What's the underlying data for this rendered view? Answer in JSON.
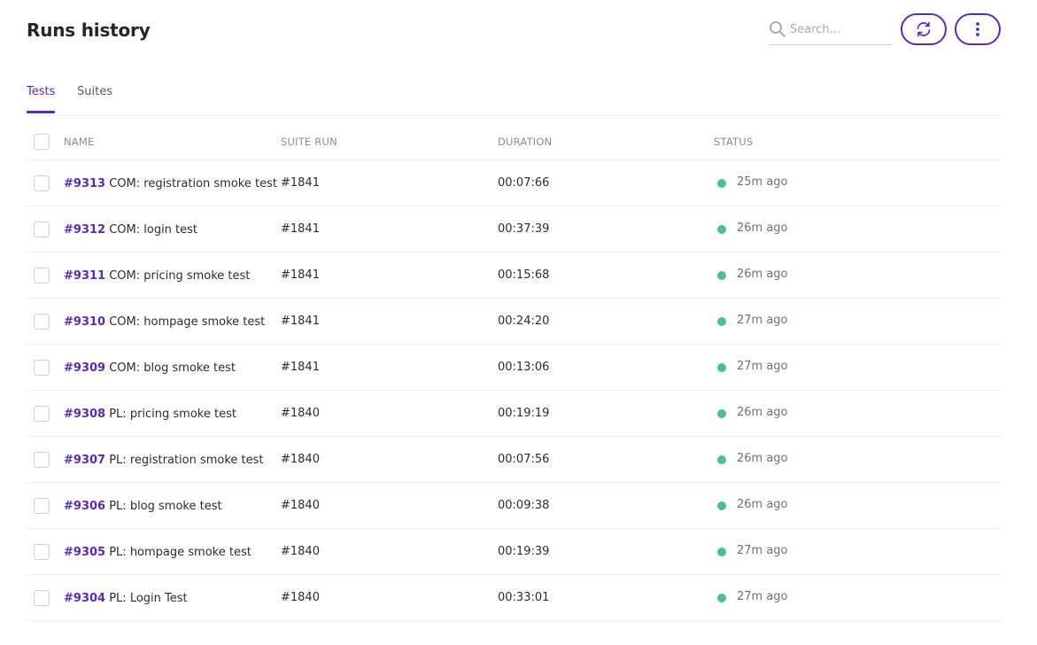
{
  "header": {
    "title": "Runs history",
    "search_placeholder": "Search...",
    "search_value": "",
    "refresh_icon": "refresh-icon",
    "more_icon": "more-vertical-icon"
  },
  "colors": {
    "accent": "#5b2bb8",
    "status_success": "#4cbf8a"
  },
  "tabs": [
    {
      "label": "Tests",
      "active": true
    },
    {
      "label": "Suites",
      "active": false
    }
  ],
  "table": {
    "columns": {
      "name": "NAME",
      "suite_run": "SUITE RUN",
      "duration": "DURATION",
      "status": "STATUS"
    },
    "rows": [
      {
        "id": "#9313",
        "name": "COM: registration smoke test",
        "suite_run": "#1841",
        "duration": "00:07:66",
        "status": "success",
        "ago": "25m ago"
      },
      {
        "id": "#9312",
        "name": "COM: login test",
        "suite_run": "#1841",
        "duration": "00:37:39",
        "status": "success",
        "ago": "26m ago"
      },
      {
        "id": "#9311",
        "name": "COM: pricing smoke test",
        "suite_run": "#1841",
        "duration": "00:15:68",
        "status": "success",
        "ago": "26m ago"
      },
      {
        "id": "#9310",
        "name": "COM: hompage smoke test",
        "suite_run": "#1841",
        "duration": "00:24:20",
        "status": "success",
        "ago": "27m ago"
      },
      {
        "id": "#9309",
        "name": "COM: blog smoke test",
        "suite_run": "#1841",
        "duration": "00:13:06",
        "status": "success",
        "ago": "27m ago"
      },
      {
        "id": "#9308",
        "name": "PL: pricing smoke test",
        "suite_run": "#1840",
        "duration": "00:19:19",
        "status": "success",
        "ago": "26m ago"
      },
      {
        "id": "#9307",
        "name": "PL: registration smoke test",
        "suite_run": "#1840",
        "duration": "00:07:56",
        "status": "success",
        "ago": "26m ago"
      },
      {
        "id": "#9306",
        "name": "PL: blog smoke test",
        "suite_run": "#1840",
        "duration": "00:09:38",
        "status": "success",
        "ago": "26m ago"
      },
      {
        "id": "#9305",
        "name": "PL: hompage smoke test",
        "suite_run": "#1840",
        "duration": "00:19:39",
        "status": "success",
        "ago": "27m ago"
      },
      {
        "id": "#9304",
        "name": "PL: Login Test",
        "suite_run": "#1840",
        "duration": "00:33:01",
        "status": "success",
        "ago": "27m ago"
      }
    ]
  }
}
